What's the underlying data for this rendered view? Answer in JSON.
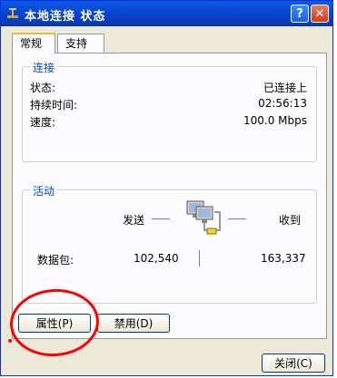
{
  "window": {
    "title": "本地连接 状态",
    "help_label": "?",
    "close_label": "✕"
  },
  "tabs": [
    {
      "label": "常规"
    },
    {
      "label": "支持"
    }
  ],
  "connection": {
    "title": "连接",
    "rows": [
      {
        "label": "状态:",
        "value": "已连接上"
      },
      {
        "label": "持续时间:",
        "value": "02:56:13"
      },
      {
        "label": "速度:",
        "value": "100.0 Mbps"
      }
    ]
  },
  "activity": {
    "title": "活动",
    "sent_label": "发送",
    "received_label": "收到",
    "packets_label": "数据包:",
    "packets_sent": "102,540",
    "packets_received": "163,337"
  },
  "buttons": {
    "properties": "属性(P)",
    "disable": "禁用(D)",
    "close": "关闭(C)"
  },
  "annotation": {
    "color": "#ff0000"
  }
}
